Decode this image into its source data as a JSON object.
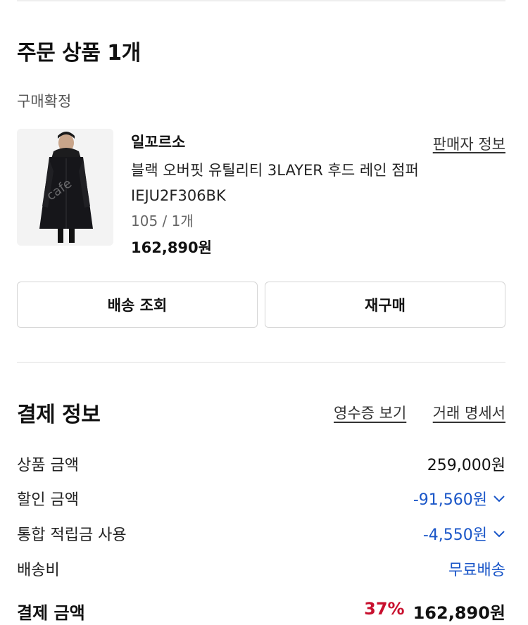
{
  "order": {
    "title": "주문 상품 1개",
    "status": "구매확정",
    "product": {
      "brand": "일꼬르소",
      "seller_link": "판매자 정보",
      "name_line1": "블랙 오버핏 유틸리티 3LAYER 후드 레인 점퍼",
      "name_line2": "IEJU2F306BK",
      "option": "105 / 1개",
      "price": "162,890원",
      "watermark": "cafe"
    },
    "buttons": {
      "tracking": "배송 조회",
      "reorder": "재구매"
    }
  },
  "payment": {
    "title": "결제 정보",
    "receipt_link": "영수증 보기",
    "statement_link": "거래 명세서",
    "rows": [
      {
        "label": "상품 금액",
        "value": "259,000원"
      },
      {
        "label": "할인 금액",
        "value": "-91,560원"
      },
      {
        "label": "통합 적립금 사용",
        "value": "-4,550원"
      },
      {
        "label": "배송비",
        "value": "무료배송"
      }
    ],
    "total": {
      "label": "결제 금액",
      "discount_pct": "37%",
      "amount": "162,890원"
    }
  },
  "colors": {
    "accent_blue": "#1a56c8",
    "discount_red": "#c8102e"
  }
}
